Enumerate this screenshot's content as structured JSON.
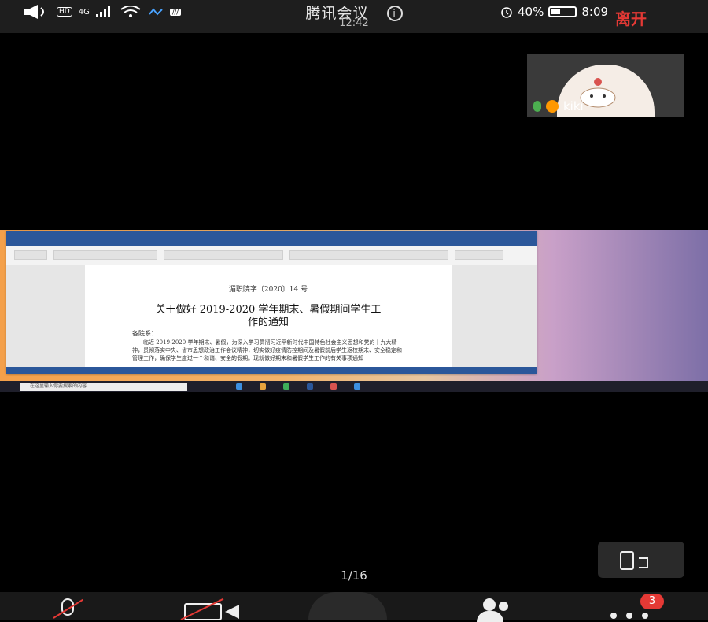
{
  "statusbar": {
    "network": "4G",
    "app_title": "腾讯会议",
    "meeting_time": "12:42",
    "battery": "40%",
    "battery_level": 0.4,
    "clock": "8:09",
    "leave_label": "离开"
  },
  "participant_tile": {
    "name": "kiki"
  },
  "shared_document": {
    "doc_number": "湄职院字〔2020〕14 号",
    "title_line1": "关于做好 2019-2020 学年期末、暑假期间学生工",
    "title_line2": "作的通知",
    "salutation": "各院系：",
    "body_line1": "　　临近 2019-2020 学年期末、暑假，为深入学习贯彻习近平新时代中国特色社会主义思想和党的十九大精神，贯彻落实中央、省市思想政治工作会议精神，切实做好疫情防控期间及暑假前后学生返校期末、安全稳定和管理工作，确保学生度过一个和谐、安全的假期。现就做好期末和暑假学生工作的有关事项通知",
    "taskbar_search": "在这里输入你要搜索的内容"
  },
  "page_indicator": "1/16",
  "toolbar": {
    "more_badge": "3"
  }
}
